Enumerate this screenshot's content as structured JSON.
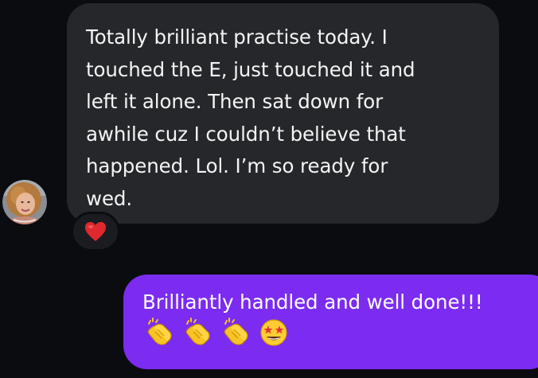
{
  "conversation": {
    "incoming_message": {
      "text": "Totally brilliant practise today. I\ntouched the E, just touched it and\nleft it alone.  Then sat down for\nawhile cuz I couldn’t believe that\nhappened.  Lol.  I’m so ready for\nwed.",
      "reaction": "red-heart-icon"
    },
    "outgoing_message": {
      "text": "Brilliantly handled and well done!!!",
      "emojis": [
        "clapping-hands-icon",
        "clapping-hands-icon",
        "clapping-hands-icon",
        "star-struck-face-icon"
      ]
    }
  },
  "colors": {
    "background": "#0b0c10",
    "incoming_bubble": "#26272b",
    "outgoing_bubble": "#7b2cf0",
    "reaction_pill": "#1b1c21",
    "heart": "#e0282f",
    "text": "#f4f4f5"
  }
}
